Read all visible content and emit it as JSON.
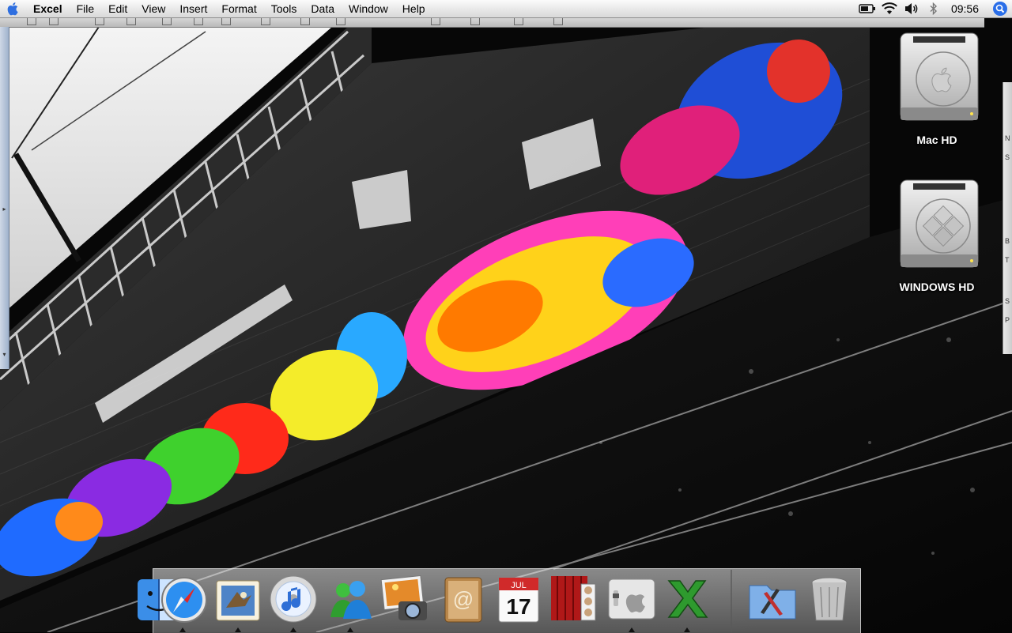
{
  "menubar": {
    "app_name": "Excel",
    "items": [
      "File",
      "Edit",
      "View",
      "Insert",
      "Format",
      "Tools",
      "Data",
      "Window",
      "Help"
    ],
    "clock": "09:56",
    "status_icons": [
      "battery-icon",
      "wifi-icon",
      "volume-icon",
      "bluetooth-icon"
    ]
  },
  "desktop": {
    "volumes": [
      {
        "label": "Mac HD",
        "icon": "hard-drive-apple-icon"
      },
      {
        "label": "WINDOWS HD",
        "icon": "hard-drive-windows-icon"
      }
    ]
  },
  "excel_window": {
    "side_panel_letters": [
      "N",
      "S",
      "B",
      "T",
      "S",
      "P"
    ]
  },
  "dock": {
    "apps": [
      {
        "name": "Finder",
        "icon": "finder-icon",
        "running": true
      },
      {
        "name": "Safari",
        "icon": "safari-icon",
        "running": false
      },
      {
        "name": "Mail",
        "icon": "mail-icon",
        "running": true
      },
      {
        "name": "iTunes",
        "icon": "itunes-icon",
        "running": true
      },
      {
        "name": "MSN Messenger",
        "icon": "msn-messenger-icon",
        "running": true
      },
      {
        "name": "iPhoto",
        "icon": "iphoto-icon",
        "running": false
      },
      {
        "name": "Address Book",
        "icon": "address-book-icon",
        "running": false
      },
      {
        "name": "iCal",
        "icon": "ical-icon",
        "running": false
      },
      {
        "name": "Photo Booth",
        "icon": "photo-booth-icon",
        "running": false
      },
      {
        "name": "System Preferences",
        "icon": "system-preferences-icon",
        "running": true
      },
      {
        "name": "Excel",
        "icon": "excel-icon",
        "running": true
      },
      {
        "name": "Applications",
        "icon": "applications-folder-icon",
        "running": false
      },
      {
        "name": "Trash",
        "icon": "trash-icon",
        "running": false
      }
    ],
    "ical_month": "JUL",
    "ical_day": "17"
  }
}
